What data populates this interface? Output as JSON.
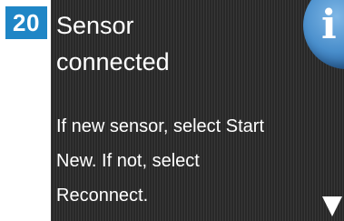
{
  "step": {
    "number": "20",
    "badge_color": "#1f86c6"
  },
  "screen": {
    "title_line1": "Sensor",
    "title_line2": "connected",
    "message_line1": "If new sensor, select Start",
    "message_line2": "New. If not, select",
    "message_line3": "Reconnect.",
    "info_icon": "info-icon",
    "scroll_icon": "scroll-down-arrow-icon",
    "info_color": "#4a8fcc"
  }
}
